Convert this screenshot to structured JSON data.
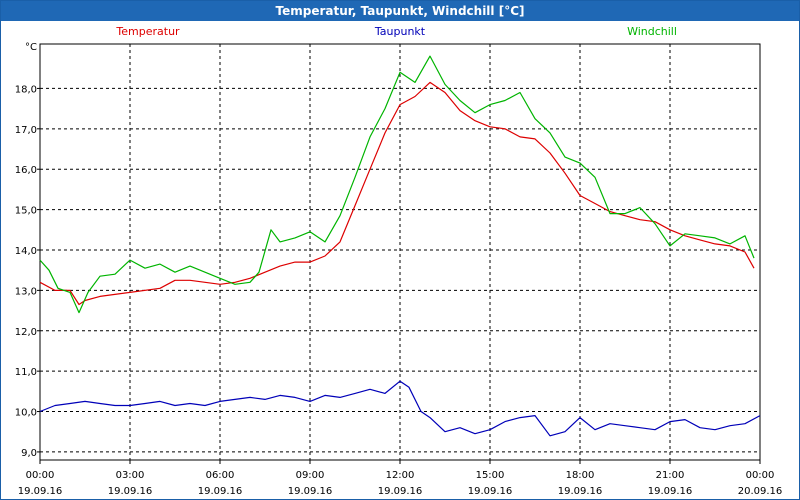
{
  "window": {
    "title": "Temperatur, Taupunkt, Windchill [°C]"
  },
  "colors": {
    "temperature": "#dd0000",
    "dewpoint": "#0000b8",
    "windchill": "#00b400",
    "grid": "#000000",
    "title_bg": "#1f68b5"
  },
  "chart_data": {
    "type": "line",
    "title": "Temperatur, Taupunkt, Windchill [°C]",
    "ylabel": "°C",
    "ylim": [
      8.8,
      19.1
    ],
    "xlim": [
      0,
      24
    ],
    "grid": true,
    "legend_placement": "top",
    "y_ticks": [
      9,
      10,
      11,
      12,
      13,
      14,
      15,
      16,
      17,
      18
    ],
    "y_tick_labels": [
      "9,0",
      "10,0",
      "11,0",
      "12,0",
      "13,0",
      "14,0",
      "15,0",
      "16,0",
      "17,0",
      "18,0"
    ],
    "x_ticks": [
      0,
      3,
      6,
      9,
      12,
      15,
      18,
      21,
      24
    ],
    "x_tick_labels": [
      [
        "00:00",
        "19.09.16"
      ],
      [
        "03:00",
        "19.09.16"
      ],
      [
        "06:00",
        "19.09.16"
      ],
      [
        "09:00",
        "19.09.16"
      ],
      [
        "12:00",
        "19.09.16"
      ],
      [
        "15:00",
        "19.09.16"
      ],
      [
        "18:00",
        "19.09.16"
      ],
      [
        "21:00",
        "19.09.16"
      ],
      [
        "00:00",
        "20.09.16"
      ]
    ],
    "series": [
      {
        "name": "Temperatur",
        "color": "#dd0000",
        "x": [
          0,
          0.5,
          1,
          1.3,
          1.5,
          2,
          3,
          4,
          4.5,
          5,
          6,
          6.5,
          7,
          7.5,
          8,
          8.5,
          9,
          9.5,
          10,
          10.5,
          11,
          11.5,
          12,
          12.5,
          13,
          13.5,
          14,
          14.5,
          15,
          15.5,
          16,
          16.5,
          17,
          17.5,
          18,
          18.5,
          19,
          19.5,
          20,
          20.5,
          21,
          21.5,
          22,
          22.5,
          23,
          23.5,
          23.8
        ],
        "y": [
          13.2,
          13.0,
          13.0,
          12.65,
          12.75,
          12.85,
          12.95,
          13.05,
          13.25,
          13.25,
          13.15,
          13.2,
          13.3,
          13.45,
          13.6,
          13.7,
          13.7,
          13.85,
          14.2,
          15.1,
          16.0,
          16.9,
          17.6,
          17.8,
          18.15,
          17.9,
          17.45,
          17.2,
          17.05,
          17.0,
          16.8,
          16.75,
          16.4,
          15.9,
          15.35,
          15.15,
          14.95,
          14.85,
          14.75,
          14.7,
          14.5,
          14.35,
          14.25,
          14.15,
          14.1,
          13.95,
          13.55
        ]
      },
      {
        "name": "Taupunkt",
        "color": "#0000b8",
        "x": [
          0,
          0.5,
          1,
          1.5,
          2,
          2.5,
          3,
          3.5,
          4,
          4.5,
          5,
          5.5,
          6,
          6.5,
          7,
          7.5,
          8,
          8.5,
          9,
          9.5,
          10,
          10.5,
          11,
          11.5,
          12,
          12.3,
          12.7,
          13,
          13.5,
          14,
          14.5,
          15,
          15.5,
          16,
          16.5,
          17,
          17.5,
          18,
          18.5,
          19,
          19.5,
          20,
          20.5,
          21,
          21.5,
          22,
          22.5,
          23,
          23.5,
          24
        ],
        "y": [
          10.0,
          10.15,
          10.2,
          10.25,
          10.2,
          10.15,
          10.15,
          10.2,
          10.25,
          10.15,
          10.2,
          10.15,
          10.25,
          10.3,
          10.35,
          10.3,
          10.4,
          10.35,
          10.25,
          10.4,
          10.35,
          10.45,
          10.55,
          10.45,
          10.75,
          10.6,
          10.0,
          9.85,
          9.5,
          9.6,
          9.45,
          9.55,
          9.75,
          9.85,
          9.9,
          9.4,
          9.5,
          9.85,
          9.55,
          9.7,
          9.65,
          9.6,
          9.55,
          9.75,
          9.8,
          9.6,
          9.55,
          9.65,
          9.7,
          9.9
        ]
      },
      {
        "name": "Windchill",
        "color": "#00b400",
        "x": [
          0,
          0.3,
          0.6,
          1,
          1.3,
          1.6,
          2,
          2.5,
          3,
          3.5,
          4,
          4.5,
          5,
          5.5,
          6,
          6.5,
          7,
          7.3,
          7.7,
          8,
          8.5,
          9,
          9.5,
          10,
          10.5,
          11,
          11.5,
          12,
          12.5,
          13,
          13.5,
          14,
          14.5,
          15,
          15.5,
          16,
          16.5,
          17,
          17.5,
          18,
          18.5,
          19,
          19.5,
          20,
          20.5,
          21,
          21.5,
          22,
          22.5,
          23,
          23.5,
          23.8
        ],
        "y": [
          13.75,
          13.5,
          13.05,
          12.95,
          12.45,
          12.95,
          13.35,
          13.4,
          13.75,
          13.55,
          13.65,
          13.45,
          13.6,
          13.45,
          13.3,
          13.15,
          13.2,
          13.45,
          14.5,
          14.2,
          14.3,
          14.45,
          14.2,
          14.85,
          15.8,
          16.8,
          17.5,
          18.4,
          18.15,
          18.8,
          18.1,
          17.7,
          17.4,
          17.6,
          17.7,
          17.9,
          17.25,
          16.9,
          16.3,
          16.15,
          15.8,
          14.9,
          14.9,
          15.05,
          14.65,
          14.1,
          14.4,
          14.35,
          14.3,
          14.15,
          14.35,
          13.8
        ]
      }
    ]
  }
}
